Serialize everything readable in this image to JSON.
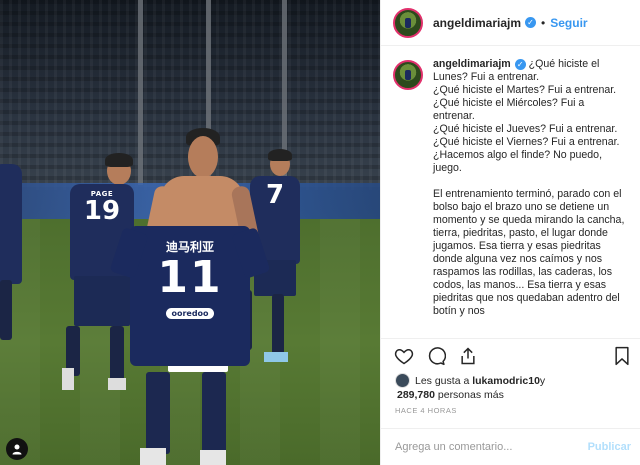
{
  "post": {
    "username": "angeldimariajm",
    "verified_glyph": "✓",
    "separator": "•",
    "follow_label": "Seguir"
  },
  "photo": {
    "held_jersey": {
      "chinese_name": "迪马利亚",
      "number": "11",
      "sponsor": "ooredoo"
    },
    "players": [
      {
        "name": "PAGE",
        "number": "19"
      },
      {
        "name": "",
        "number": "7"
      }
    ]
  },
  "caption": {
    "username": "angeldimariajm",
    "text": " ¿Qué hiciste el Lunes? Fui a entrenar.\n¿Qué hiciste el Martes? Fui a entrenar.\n¿Qué hiciste el Miércoles? Fui a entrenar.\n¿Qué hiciste el Jueves? Fui a entrenar.\n¿Qué hiciste el Viernes? Fui a entrenar.\n¿Hacemos algo el finde? No puedo, juego.\n\nEl entrenamiento terminó, parado con el bolso bajo el brazo uno se detiene un momento y se queda mirando la cancha, tierra, piedritas, pasto, el lugar donde jugamos. Esa tierra y esas piedritas donde alguna vez nos caímos y nos raspamos las rodillas, las caderas, los codos, las manos... Esa tierra y esas piedritas que nos quedaban adentro del botín y nos"
  },
  "likes": {
    "prefix": "Les gusta a ",
    "first_user": "lukamodric10",
    "mid": " y",
    "count": "289,780",
    "suffix": " personas más"
  },
  "timestamp": "HACE 4 HORAS",
  "comment_box": {
    "placeholder": "Agrega un comentario...",
    "publish_label": "Publicar"
  },
  "icons": {
    "like": "heart-icon",
    "comment": "comment-icon",
    "share": "share-icon",
    "save": "bookmark-icon",
    "verified": "verified-badge-icon"
  },
  "colors": {
    "accent": "#3897f0",
    "publish_disabled": "#b2dffc",
    "story_ring": "#e1306c",
    "jersey": "#1b2a5e"
  }
}
